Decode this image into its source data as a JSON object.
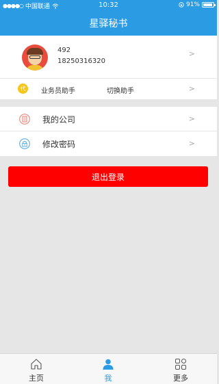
{
  "statusbar": {
    "carrier": "中国联通",
    "signal_dots": "●●●●○",
    "time": "10:32",
    "battery": "91%"
  },
  "nav": {
    "title": "星驿秘书"
  },
  "profile": {
    "id": "492",
    "phone": "18250316320",
    "chevron": ">"
  },
  "assistant": {
    "badge": "代",
    "role": "业务员助手",
    "switch_label": "切换助手",
    "chevron": ">"
  },
  "menu": {
    "items": [
      {
        "label": "我的公司",
        "icon": "building-icon",
        "chevron": ">"
      },
      {
        "label": "修改密码",
        "icon": "lock-icon",
        "chevron": ">"
      }
    ]
  },
  "logout": {
    "label": "退出登录"
  },
  "tabbar": {
    "tabs": [
      {
        "label": "主页",
        "icon": "home-icon",
        "active": false
      },
      {
        "label": "我",
        "icon": "person-icon",
        "active": true
      },
      {
        "label": "更多",
        "icon": "grid-icon",
        "active": false
      }
    ]
  },
  "colors": {
    "primary": "#2b9be4",
    "danger": "#ff0000",
    "badge": "#f5c518"
  }
}
